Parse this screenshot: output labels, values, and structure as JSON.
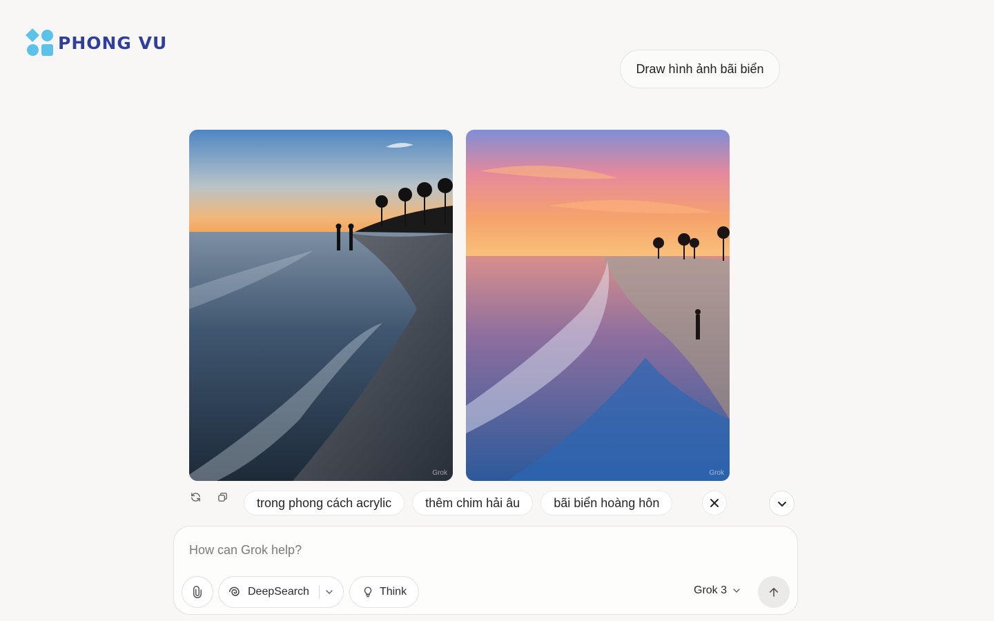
{
  "brand": {
    "logo_text": "PHONG VU",
    "color": "#2f3f9a",
    "accent": "#5cc2ea"
  },
  "conversation": {
    "user_message": "Draw hình ảnh bãi biển",
    "images": [
      {
        "watermark": "Grok"
      },
      {
        "watermark": "Grok"
      }
    ],
    "actions": {
      "regenerate_icon": "refresh-icon",
      "copy_icon": "copy-icon"
    }
  },
  "suggestions": [
    {
      "label": "trong phong cách acrylic"
    },
    {
      "label": "thêm chim hải âu"
    },
    {
      "label": "bãi biển hoàng hôn"
    }
  ],
  "composer": {
    "placeholder": "How can Grok help?",
    "deepsearch_label": "DeepSearch",
    "think_label": "Think",
    "model_label": "Grok 3"
  }
}
